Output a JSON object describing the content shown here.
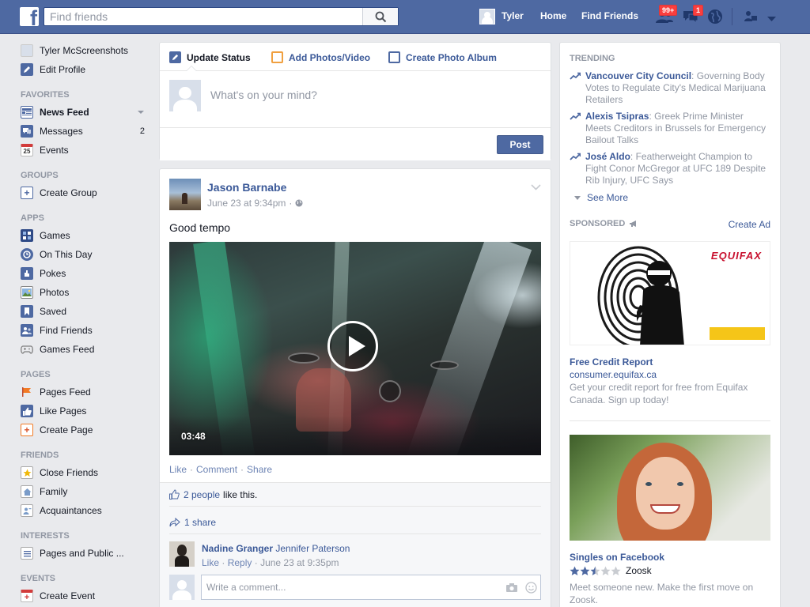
{
  "topbar": {
    "logo": "f",
    "search_placeholder": "Find friends",
    "user_name": "Tyler",
    "home": "Home",
    "find_friends": "Find Friends",
    "friend_requests_badge": "99+",
    "messages_badge": "1",
    "colors": {
      "bar": "#4e69a2",
      "badge": "#fa3e3e"
    }
  },
  "sidebar": {
    "profile_name": "Tyler McScreenshots",
    "edit_profile": "Edit Profile",
    "favorites_header": "FAVORITES",
    "favorites": [
      {
        "label": "News Feed",
        "icon": "news-feed-icon"
      },
      {
        "label": "Messages",
        "icon": "messages-icon",
        "count": "2"
      },
      {
        "label": "Events",
        "icon": "events-icon",
        "glyph": "25"
      }
    ],
    "groups_header": "GROUPS",
    "groups": [
      {
        "label": "Create Group",
        "icon": "create-group-icon"
      }
    ],
    "apps_header": "APPS",
    "apps": [
      {
        "label": "Games",
        "icon": "games-icon"
      },
      {
        "label": "On This Day",
        "icon": "on-this-day-icon"
      },
      {
        "label": "Pokes",
        "icon": "pokes-icon"
      },
      {
        "label": "Photos",
        "icon": "photos-icon"
      },
      {
        "label": "Saved",
        "icon": "saved-icon"
      },
      {
        "label": "Find Friends",
        "icon": "find-friends-icon"
      },
      {
        "label": "Games Feed",
        "icon": "games-feed-icon"
      }
    ],
    "pages_header": "PAGES",
    "pages": [
      {
        "label": "Pages Feed",
        "icon": "pages-feed-icon"
      },
      {
        "label": "Like Pages",
        "icon": "like-pages-icon"
      },
      {
        "label": "Create Page",
        "icon": "create-page-icon"
      }
    ],
    "friends_header": "FRIENDS",
    "friends": [
      {
        "label": "Close Friends",
        "icon": "close-friends-icon"
      },
      {
        "label": "Family",
        "icon": "family-icon"
      },
      {
        "label": "Acquaintances",
        "icon": "acquaintances-icon"
      }
    ],
    "interests_header": "INTERESTS",
    "interests": [
      {
        "label": "Pages and Public ...",
        "icon": "pages-public-icon"
      }
    ],
    "events_header": "EVENTS",
    "events": [
      {
        "label": "Create Event",
        "icon": "create-event-icon"
      }
    ]
  },
  "composer": {
    "tabs": [
      "Update Status",
      "Add Photos/Video",
      "Create Photo Album"
    ],
    "placeholder": "What's on your mind?",
    "post_label": "Post"
  },
  "post": {
    "author": "Jason Barnabe",
    "timestamp": "June 23 at 9:34pm",
    "separator": "·",
    "text": "Good tempo",
    "video_duration": "03:48",
    "actions": [
      "Like",
      "Comment",
      "Share"
    ],
    "likes_link": "2 people",
    "likes_suffix": "like this.",
    "shares": "1 share",
    "comment": {
      "author": "Nadine Granger",
      "text": "Jennifer Paterson",
      "like": "Like",
      "reply": "Reply",
      "timestamp": "June 23 at 9:35pm"
    },
    "write_placeholder": "Write a comment..."
  },
  "right": {
    "trending_header": "TRENDING",
    "trending": [
      {
        "topic": "Vancouver City Council",
        "desc": ": Governing Body Votes to Regulate City's Medical Marijuana Retailers"
      },
      {
        "topic": "Alexis Tsipras",
        "desc": ": Greek Prime Minister Meets Creditors in Brussels for Emergency Bailout Talks"
      },
      {
        "topic": "José Aldo",
        "desc": ": Featherweight Champion to Fight Conor McGregor at UFC 189 Despite Rib Injury, UFC Says"
      }
    ],
    "see_more": "See More",
    "sponsored_header": "SPONSORED",
    "create_ad": "Create Ad",
    "ads": [
      {
        "brand": "EQUIFAX",
        "title": "Free Credit Report",
        "url": "consumer.equifax.ca",
        "desc": "Get your credit report for free from Equifax Canada. Sign up today!"
      },
      {
        "title": "Singles on Facebook",
        "rating": 2.5,
        "rating_max": 5,
        "rating_source": "Zoosk",
        "desc": "Meet someone new. Make the first move on Zoosk."
      }
    ]
  }
}
